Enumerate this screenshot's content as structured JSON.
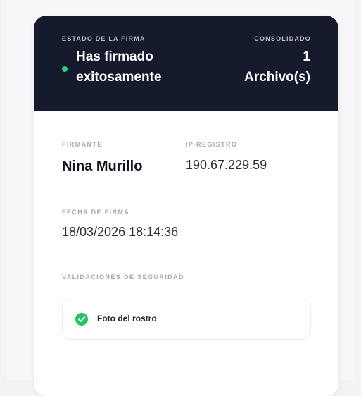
{
  "header": {
    "status_label": "ESTADO DE LA FIRMA",
    "status_text": "Has firmado exitosamente",
    "consolidated_label": "CONSOLIDADO",
    "file_count": "1",
    "file_label": "Archivo(s)",
    "status_color": "#31d07a"
  },
  "details": {
    "signer_label": "FIRMANTE",
    "signer_name": "Nina Murillo",
    "ip_label": "IP REGISTRO",
    "ip_value": "190.67.229.59",
    "date_label": "FECHA DE FIRMA",
    "date_value": "18/03/2026 18:14:36"
  },
  "security": {
    "label": "VALIDACIONES DE SEGURIDAD",
    "items": [
      {
        "label": "Foto del rostro",
        "icon": "check-circle-icon",
        "color": "#22c55e"
      }
    ]
  }
}
